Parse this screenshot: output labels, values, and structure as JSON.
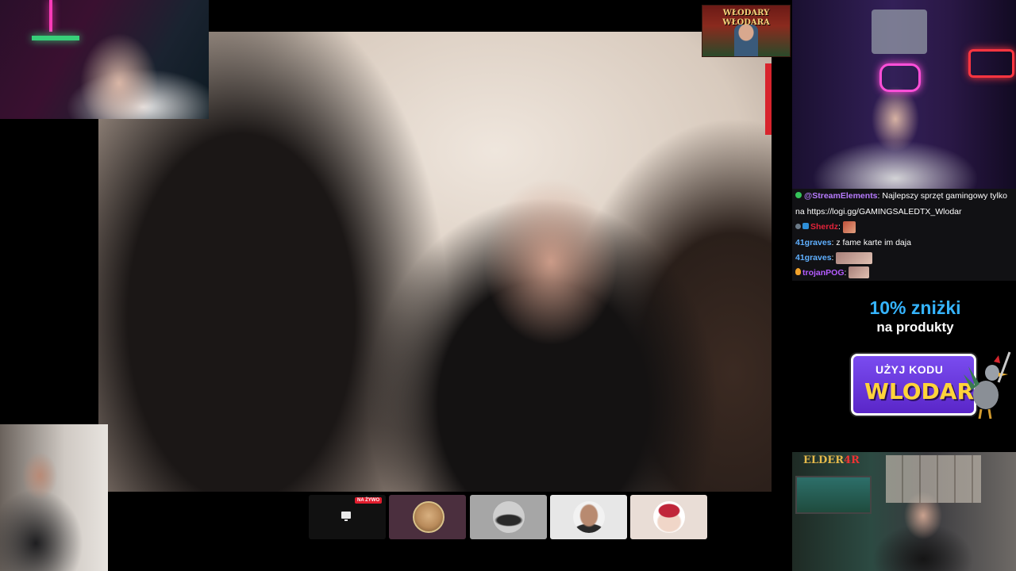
{
  "chat": {
    "messages": [
      {
        "user": "@StreamElements",
        "text": "Najlepszy sprzęt gamingowy tylko",
        "continuation": "na https://logi.gg/GAMINGSALEDTX_Wlodar",
        "user_color": "#b87cff",
        "badge": "check-icon"
      },
      {
        "user": "Sherdz",
        "text": "",
        "user_color": "#e3233a",
        "badge": "shield-icon",
        "emote": true
      },
      {
        "user": "41graves",
        "text": "z fame karte im daja",
        "user_color": "#5fb0ff"
      },
      {
        "user": "41graves",
        "text": "",
        "user_color": "#5fb0ff",
        "emote": true
      },
      {
        "user": "trojanPOG",
        "text": "",
        "user_color": "#b45cff",
        "badge": "flame-icon",
        "emote": true
      }
    ]
  },
  "badge": {
    "line1": "WŁODARY",
    "line2": "WŁODARA"
  },
  "promo": {
    "line1": "10% zniżki",
    "line2": "na produkty",
    "code_label": "UŻYJ KODU",
    "code_value": "WLODAR"
  },
  "webcam_logo": {
    "part1": "ELDER",
    "part2": "4R"
  },
  "participants": {
    "live_label": "NA ŻYWO"
  },
  "colors": {
    "accent_purple": "#5a26c8",
    "code_yellow": "#ffd43a",
    "live_red": "#e11d2e",
    "promo_blue": "#35b4ff"
  }
}
